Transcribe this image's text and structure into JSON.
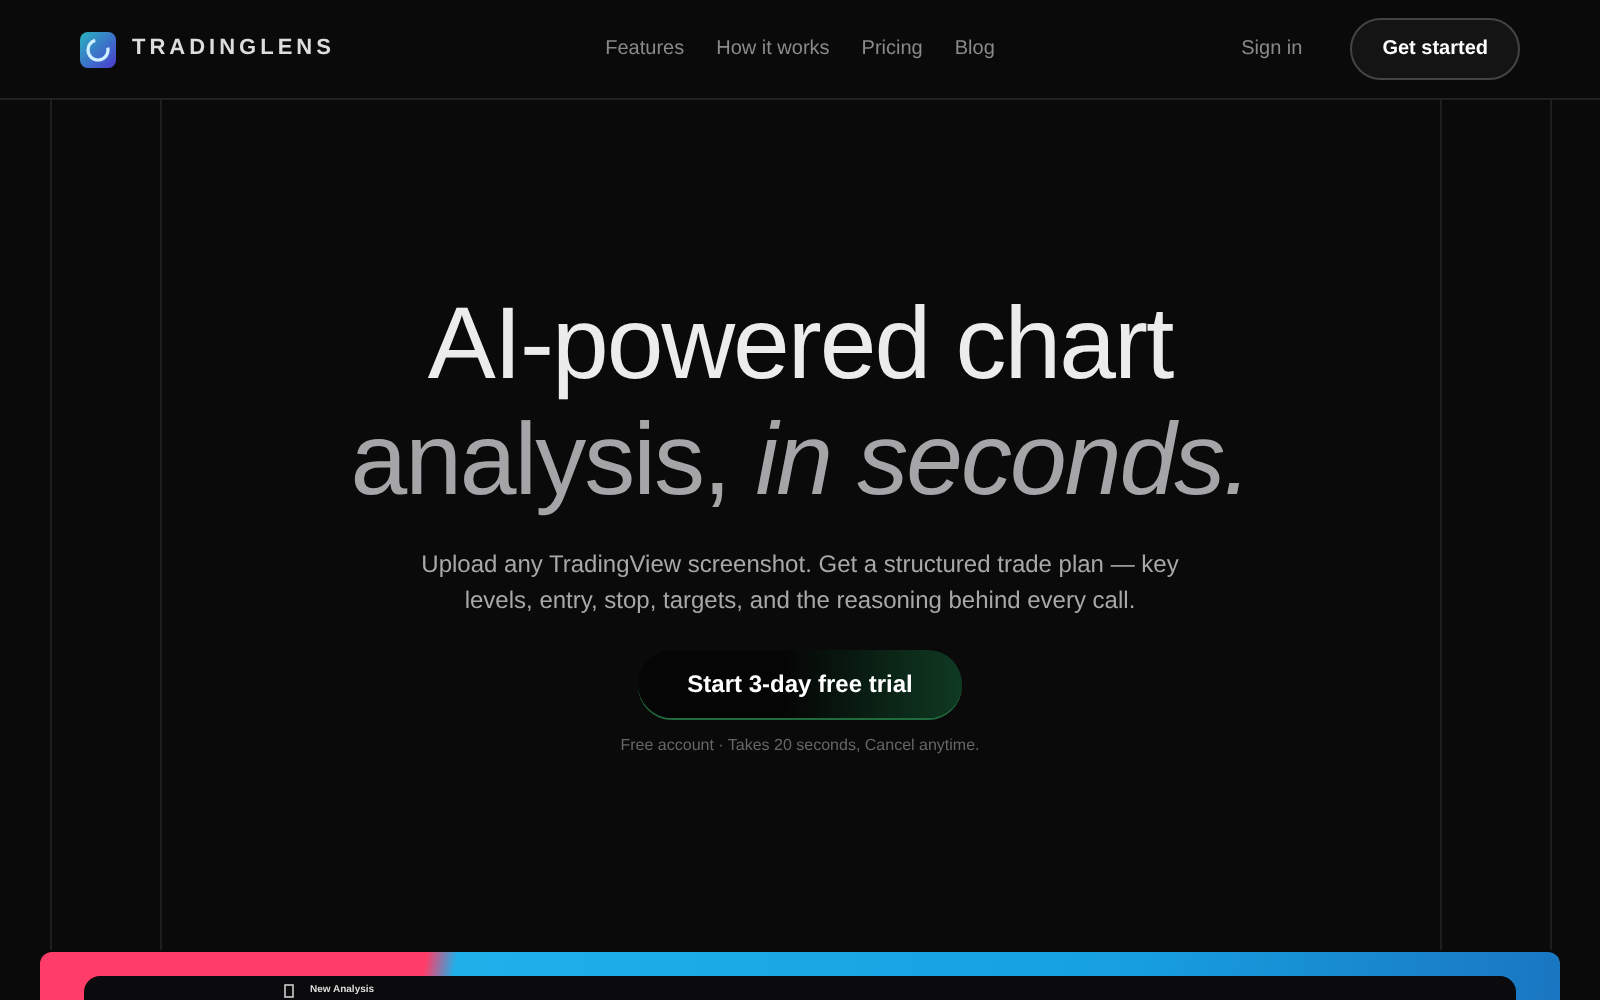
{
  "brand": {
    "name": "TRADINGLENS"
  },
  "nav": {
    "links": [
      "Features",
      "How it works",
      "Pricing",
      "Blog"
    ],
    "sign_in": "Sign in",
    "cta": "Get started"
  },
  "hero": {
    "title_line_1": "AI-powered chart",
    "title_line_2": "analysis, *in seconds.*",
    "subtitle": "Upload any TradingView screenshot. Get a structured trade plan — key levels, entry, stop, targets, and the reasoning behind every call.",
    "cta": "Start 3-day free trial",
    "note": "Free account · Takes 20 seconds, Cancel anytime."
  },
  "preview": {
    "panel_title": "New Analysis"
  }
}
